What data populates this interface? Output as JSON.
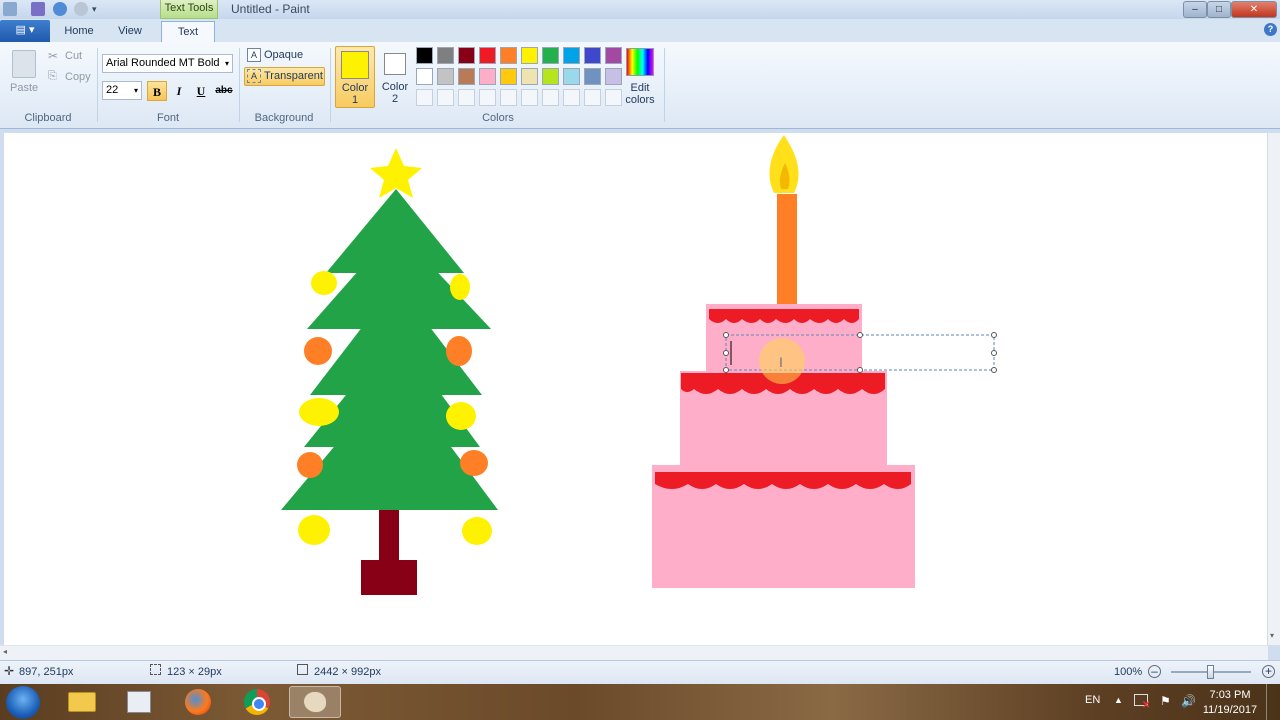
{
  "titlebar": {
    "context_tab": "Text Tools",
    "doc_title": "Untitled - Paint",
    "min": "–",
    "max": "□",
    "close": "✕"
  },
  "tabs": {
    "home": "Home",
    "view": "View",
    "text": "Text",
    "help": "?"
  },
  "clipboard": {
    "paste": "Paste",
    "cut": "Cut",
    "copy": "Copy",
    "group": "Clipboard"
  },
  "font": {
    "family": "Arial Rounded MT Bold",
    "size": "22",
    "bold": "B",
    "italic": "I",
    "underline": "U",
    "strike": "abc",
    "group": "Font"
  },
  "background": {
    "opaque": "Opaque",
    "transparent": "Transparent",
    "group": "Background"
  },
  "colors": {
    "color1_label_a": "Color",
    "color1_label_b": "1",
    "color2_label_a": "Color",
    "color2_label_b": "2",
    "color1": "#fff200",
    "color2": "#ffffff",
    "edit_a": "Edit",
    "edit_b": "colors",
    "group": "Colors",
    "row1": [
      "#000000",
      "#7f7f7f",
      "#880015",
      "#ed1c24",
      "#ff7f27",
      "#fff200",
      "#22b14c",
      "#00a2e8",
      "#3f48cc",
      "#a349a4"
    ],
    "row2": [
      "#ffffff",
      "#c3c3c3",
      "#b97a57",
      "#ffaec9",
      "#ffc90e",
      "#efe4b0",
      "#b5e61d",
      "#99d9ea",
      "#7092be",
      "#c8bfe7"
    ]
  },
  "status": {
    "cursor_pos": "897, 251px",
    "selection_size": "123 × 29px",
    "image_size": "2442 × 992px",
    "zoom": "100%"
  },
  "taskbar": {
    "lang": "EN",
    "time": "7:03 PM",
    "date": "11/19/2017"
  }
}
